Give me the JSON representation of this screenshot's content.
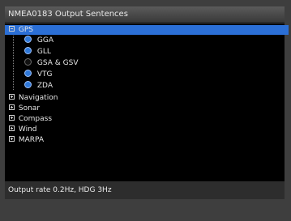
{
  "window": {
    "title": "NMEA0183 Output Sentences"
  },
  "tree": {
    "gps": {
      "label": "GPS"
    },
    "sentences": [
      {
        "label": "GGA",
        "enabled": true
      },
      {
        "label": "GLL",
        "enabled": true
      },
      {
        "label": "GSA & GSV",
        "enabled": false
      },
      {
        "label": "VTG",
        "enabled": true
      },
      {
        "label": "ZDA",
        "enabled": true
      }
    ],
    "groups": [
      "Navigation",
      "Sonar",
      "Compass",
      "Wind",
      "MARPA"
    ]
  },
  "status": {
    "text": "Output rate 0.2Hz, HDG 3Hz"
  },
  "colors": {
    "selection": "#2b6fd6",
    "radio_on": "#2f78d8"
  }
}
